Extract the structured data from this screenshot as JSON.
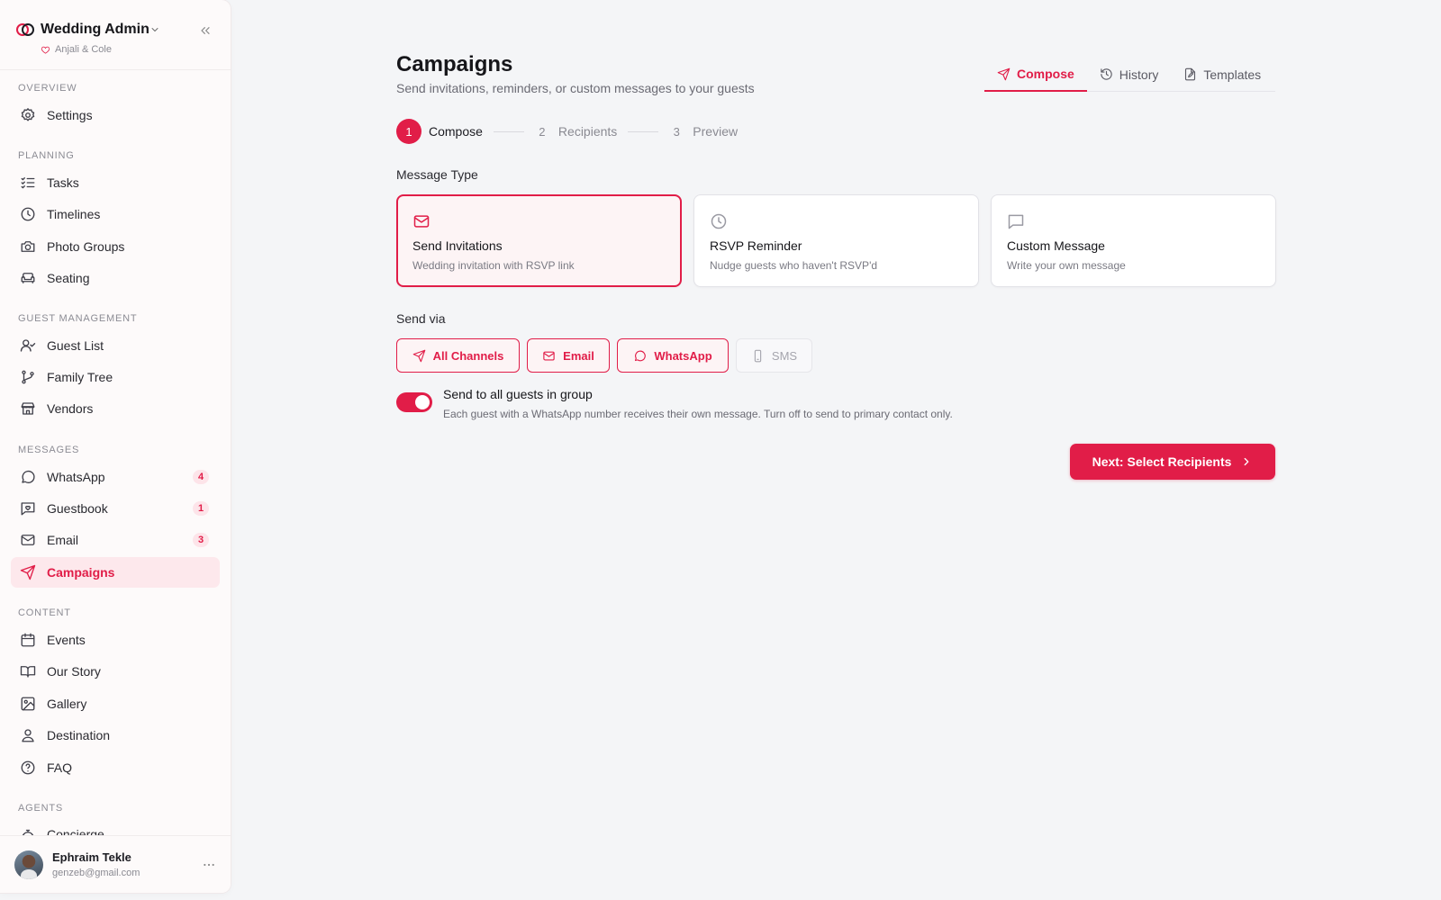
{
  "sidebar": {
    "title": "Wedding Admin",
    "subtitle": "Anjali & Cole",
    "sections": {
      "overview": "OVERVIEW",
      "planning": "PLANNING",
      "guest": "GUEST MANAGEMENT",
      "messages": "MESSAGES",
      "content": "CONTENT",
      "agents": "AGENTS"
    },
    "items": {
      "settings": "Settings",
      "tasks": "Tasks",
      "timelines": "Timelines",
      "photo_groups": "Photo Groups",
      "seating": "Seating",
      "guest_list": "Guest List",
      "family_tree": "Family Tree",
      "vendors": "Vendors",
      "whatsapp": "WhatsApp",
      "guestbook": "Guestbook",
      "email": "Email",
      "campaigns": "Campaigns",
      "events": "Events",
      "our_story": "Our Story",
      "gallery": "Gallery",
      "destination": "Destination",
      "faq": "FAQ",
      "concierge": "Concierge"
    },
    "badges": {
      "whatsapp": "4",
      "guestbook": "1",
      "email": "3"
    },
    "user": {
      "name": "Ephraim Tekle",
      "email": "genzeb@gmail.com"
    }
  },
  "header": {
    "title": "Campaigns",
    "subtitle": "Send invitations, reminders, or custom messages to your guests",
    "tabs": {
      "compose": "Compose",
      "history": "History",
      "templates": "Templates"
    }
  },
  "stepper": {
    "steps": [
      {
        "num": "1",
        "label": "Compose"
      },
      {
        "num": "2",
        "label": "Recipients"
      },
      {
        "num": "3",
        "label": "Preview"
      }
    ]
  },
  "message_type": {
    "label": "Message Type",
    "cards": [
      {
        "title": "Send Invitations",
        "desc": "Wedding invitation with RSVP link"
      },
      {
        "title": "RSVP Reminder",
        "desc": "Nudge guests who haven't RSVP'd"
      },
      {
        "title": "Custom Message",
        "desc": "Write your own message"
      }
    ]
  },
  "send_via": {
    "label": "Send via",
    "channels": [
      "All Channels",
      "Email",
      "WhatsApp",
      "SMS"
    ]
  },
  "group_toggle": {
    "title": "Send to all guests in group",
    "desc": "Each guest with a WhatsApp number receives their own message. Turn off to send to primary contact only.",
    "on": true
  },
  "next_button": "Next: Select Recipients",
  "colors": {
    "accent": "#e11d48",
    "accent_soft": "#fde8ec",
    "background": "#f4f5f7"
  }
}
